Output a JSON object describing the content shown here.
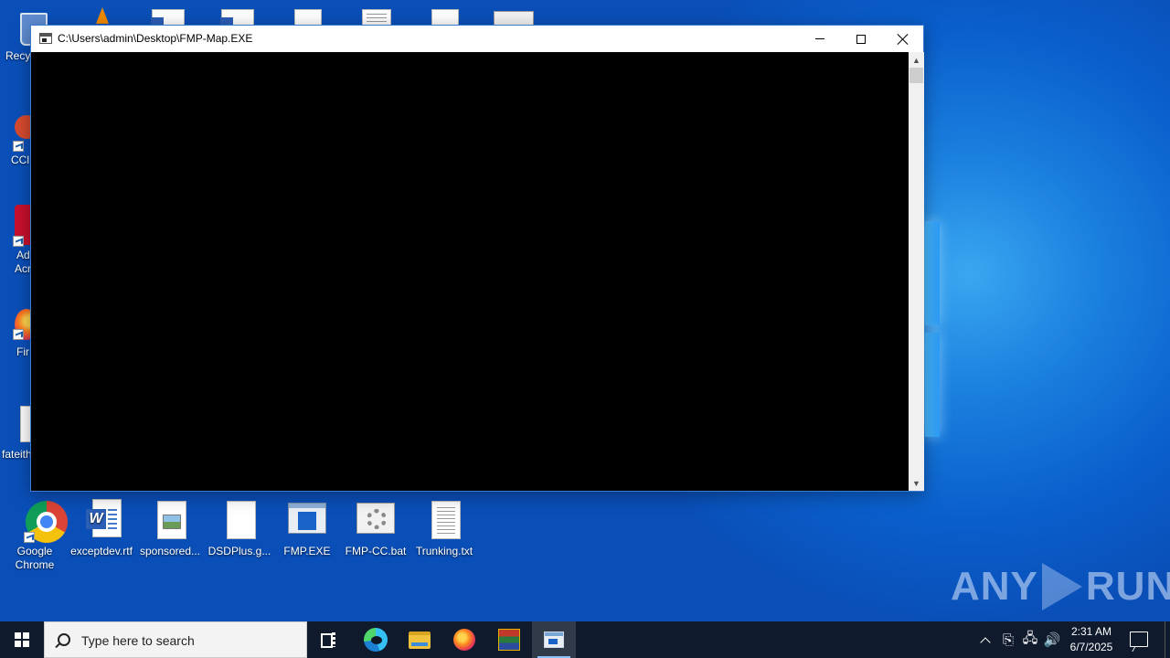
{
  "window": {
    "title": "C:\\Users\\admin\\Desktop\\FMP-Map.EXE",
    "controls": {
      "minimize": "minimize",
      "maximize": "maximize",
      "close": "close"
    }
  },
  "desktop": {
    "left_column_partial_labels": [
      "Recy",
      "CCl",
      "Ad",
      "Acr",
      "Fir",
      "fateith"
    ],
    "icons": [
      {
        "label": "Google\nChrome",
        "icon": "chrome-icon"
      },
      {
        "label": "exceptdev.rtf",
        "icon": "word-document-icon"
      },
      {
        "label": "sponsored...",
        "icon": "image-file-icon"
      },
      {
        "label": "DSDPlus.g...",
        "icon": "blank-file-icon"
      },
      {
        "label": "FMP.EXE",
        "icon": "exe-icon"
      },
      {
        "label": "FMP-CC.bat",
        "icon": "batch-file-icon"
      },
      {
        "label": "Trunking.txt",
        "icon": "text-file-icon"
      }
    ]
  },
  "watermark": {
    "left": "ANY",
    "right": "RUN"
  },
  "taskbar": {
    "search_placeholder": "Type here to search",
    "apps": [
      "task-view",
      "edge",
      "file-explorer",
      "firefox",
      "winrar",
      "console"
    ],
    "clock": {
      "time": "2:31 AM",
      "date": "6/7/2025"
    }
  },
  "colors": {
    "desktop_blue": "#0a5fcc",
    "taskbar": "#101827",
    "console_bg": "#000000",
    "window_border": "#3b7bd0"
  }
}
